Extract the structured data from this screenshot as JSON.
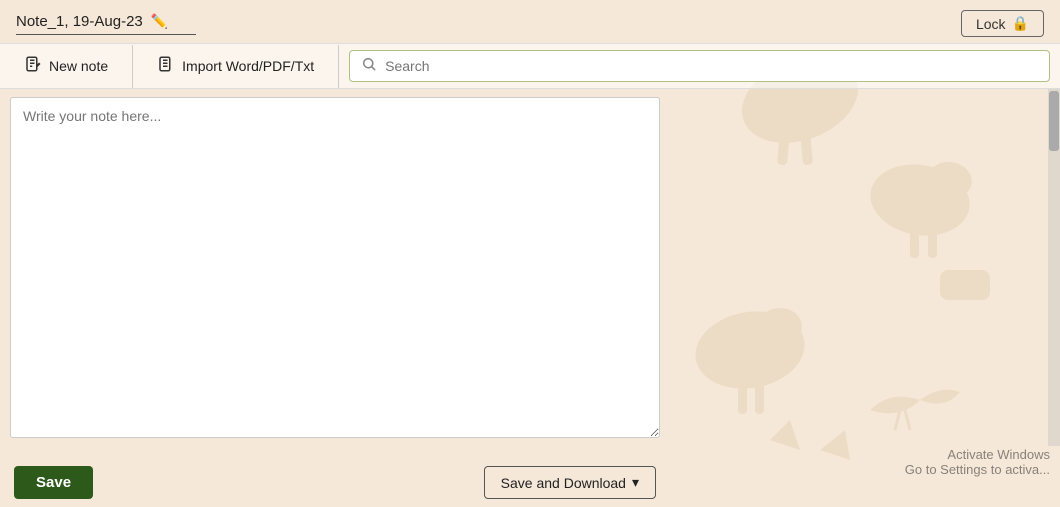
{
  "header": {
    "note_title": "Note_1, 19-Aug-23",
    "lock_label": "Lock",
    "lock_icon": "🔒"
  },
  "toolbar": {
    "new_note_label": "New note",
    "new_note_icon": "📋",
    "import_label": "Import Word/PDF/Txt",
    "import_icon": "📄",
    "search_placeholder": "Search",
    "search_icon": "✏️"
  },
  "editor": {
    "placeholder": "Write your note here..."
  },
  "footer": {
    "save_label": "Save",
    "save_download_label": "Save and Download",
    "chevron_icon": "▾"
  },
  "watermark": {
    "line1": "Activate Windows",
    "line2": "Go to Settings to activa..."
  }
}
